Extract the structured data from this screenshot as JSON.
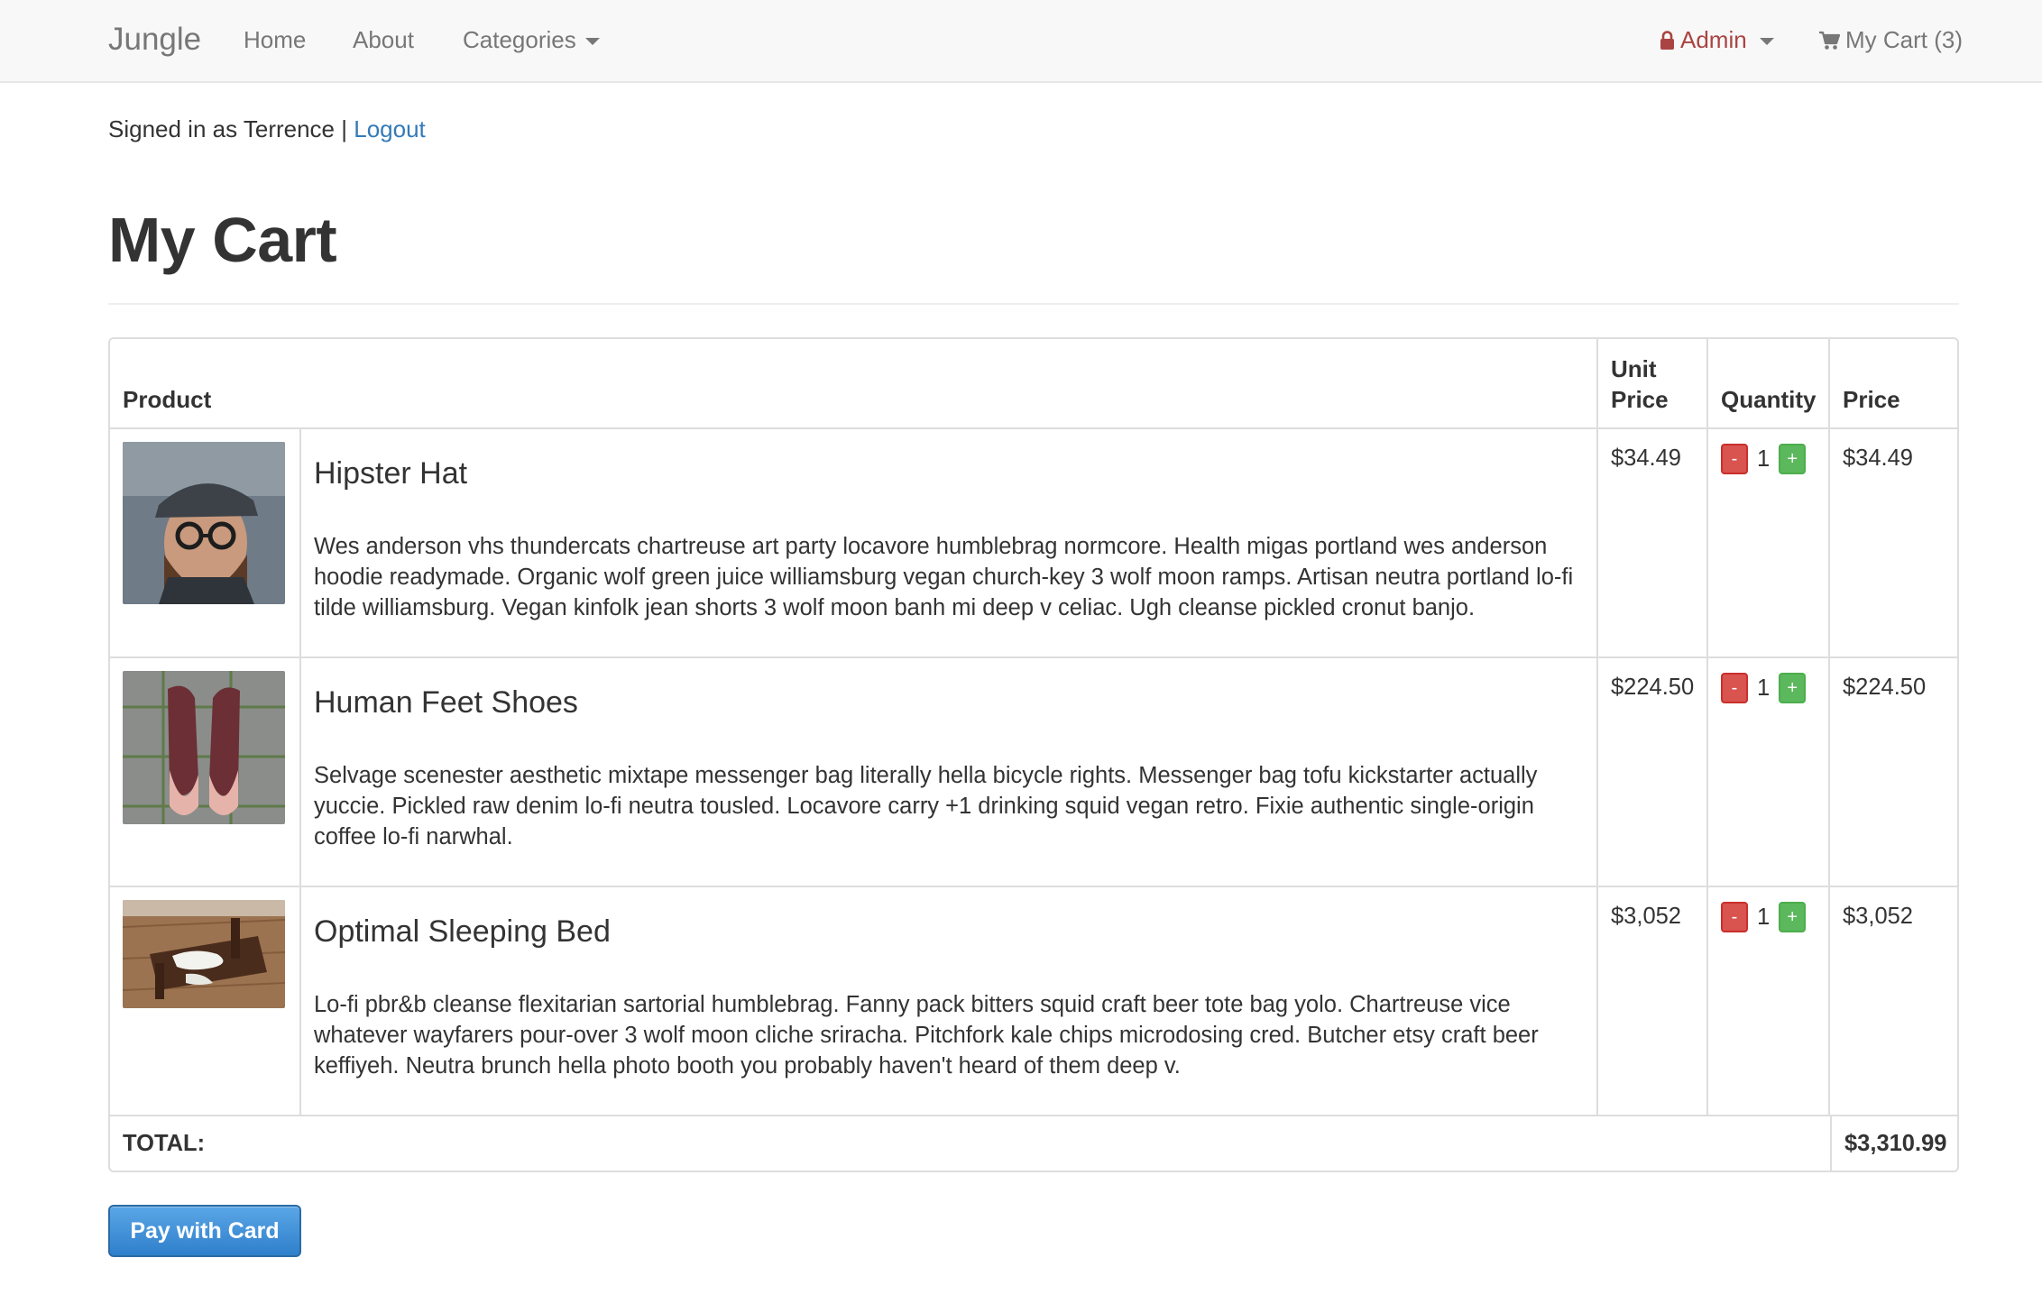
{
  "navbar": {
    "brand": "Jungle",
    "links": [
      "Home",
      "About",
      "Categories"
    ],
    "admin_label": "Admin",
    "cart_label": "My Cart (3)"
  },
  "session": {
    "signed_in_text": "Signed in as Terrence |",
    "logout_label": "Logout"
  },
  "page": {
    "title": "My Cart"
  },
  "table": {
    "headers": {
      "product": "Product",
      "unit_price": "Unit Price",
      "quantity": "Quantity",
      "price": "Price"
    },
    "items": [
      {
        "name": "Hipster Hat",
        "description": "Wes anderson vhs thundercats chartreuse art party locavore humblebrag normcore. Health migas portland wes anderson hoodie readymade. Organic wolf green juice williamsburg vegan church-key 3 wolf moon ramps. Artisan neutra portland lo-fi tilde williamsburg. Vegan kinfolk jean shorts 3 wolf moon banh mi deep v celiac. Ugh cleanse pickled cronut banjo.",
        "unit_price": "$34.49",
        "quantity": "1",
        "price": "$34.49",
        "image": "man-with-hat-photo"
      },
      {
        "name": "Human Feet Shoes",
        "description": "Selvage scenester aesthetic mixtape messenger bag literally hella bicycle rights. Messenger bag tofu kickstarter actually yuccie. Pickled raw denim lo-fi neutra tousled. Locavore carry +1 drinking squid vegan retro. Fixie authentic single-origin coffee lo-fi narwhal.",
        "unit_price": "$224.50",
        "quantity": "1",
        "price": "$224.50",
        "image": "feet-shoes-photo"
      },
      {
        "name": "Optimal Sleeping Bed",
        "description": "Lo-fi pbr&b cleanse flexitarian sartorial humblebrag. Fanny pack bitters squid craft beer tote bag yolo. Chartreuse vice whatever wayfarers pour-over 3 wolf moon cliche sriracha. Pitchfork kale chips microdosing cred. Butcher etsy craft beer keffiyeh. Neutra brunch hella photo booth you probably haven't heard of them deep v.",
        "unit_price": "$3,052",
        "quantity": "1",
        "price": "$3,052",
        "image": "bed-photo"
      }
    ],
    "qty_minus": "-",
    "qty_plus": "+",
    "total_label": "TOTAL:",
    "total_value": "$3,310.99"
  },
  "actions": {
    "pay_label": "Pay with Card"
  },
  "colors": {
    "navbar_bg": "#f8f8f8",
    "link": "#337ab7",
    "admin": "#a94442",
    "minus_btn": "#d9534f",
    "plus_btn": "#5cb85c",
    "pay_btn": "#3a8bd6"
  }
}
